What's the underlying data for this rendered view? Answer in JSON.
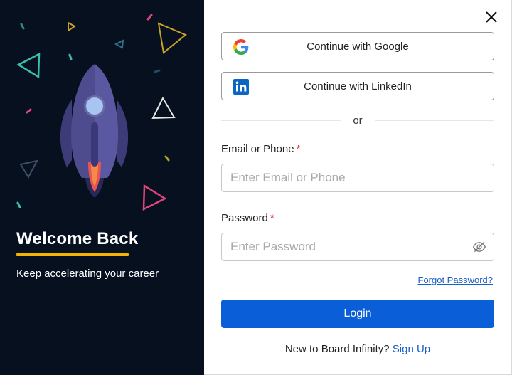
{
  "left": {
    "title": "Welcome Back",
    "subtitle": "Keep accelerating your career",
    "accent_color": "#f5b301",
    "background_color": "#07101f"
  },
  "close": {
    "icon": "close-icon"
  },
  "social": {
    "google_label": "Continue with Google",
    "google_icon": "google-g-icon",
    "linkedin_label": "Continue with LinkedIn",
    "linkedin_icon": "linkedin-icon"
  },
  "divider": {
    "text": "or"
  },
  "form": {
    "email_label": "Email or Phone",
    "email_placeholder": "Enter Email or Phone",
    "email_value": "",
    "password_label": "Password",
    "password_placeholder": "Enter Password",
    "password_value": "",
    "required_marker": "*",
    "password_toggle_icon": "eye-hidden-icon",
    "forgot_label": "Forgot Password?",
    "login_label": "Login",
    "login_color": "#0a5fd8"
  },
  "signup": {
    "prompt": "New to Board Infinity?",
    "link_label": "Sign Up"
  }
}
